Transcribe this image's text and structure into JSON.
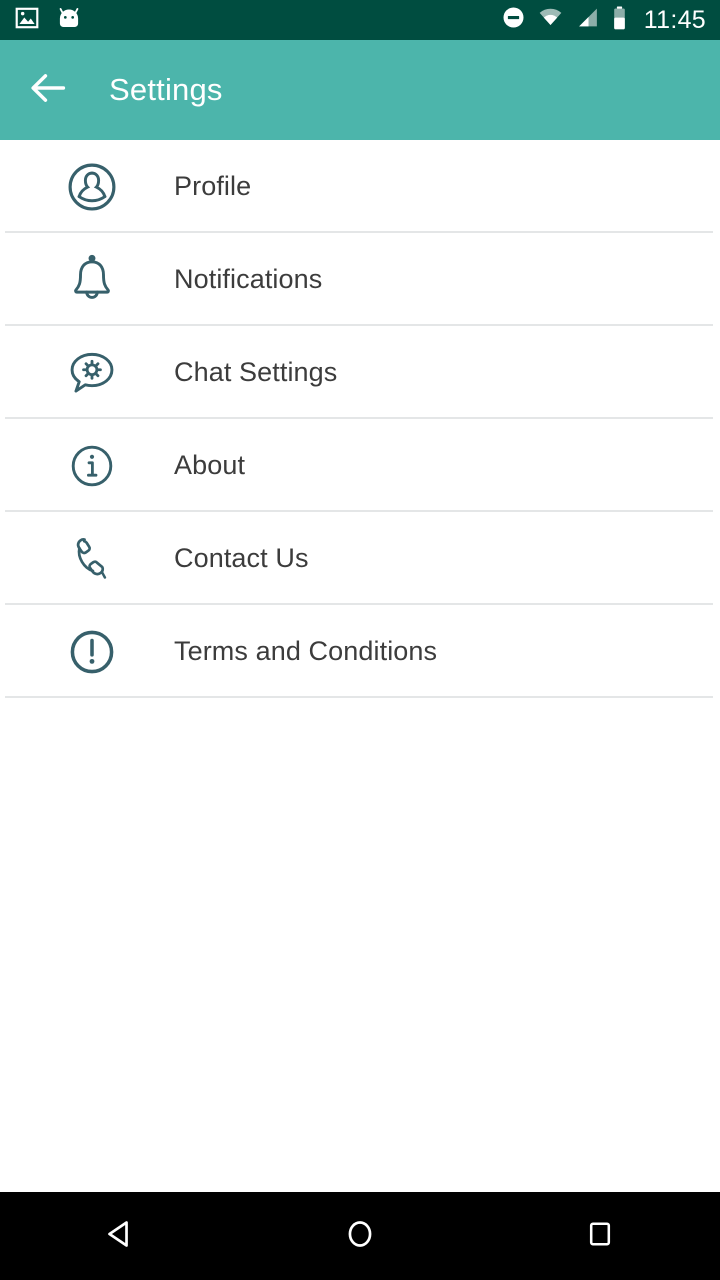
{
  "status_bar": {
    "time": "11:45",
    "background_color": "#004D40",
    "left_icons": [
      {
        "name": "photo-image-icon",
        "label": "Image"
      },
      {
        "name": "android-bugdroid-icon",
        "label": "Android"
      }
    ],
    "right_icons": [
      {
        "name": "do-not-disturb-icon",
        "label": "Do Not Disturb"
      },
      {
        "name": "wifi-icon",
        "label": "Wi-Fi"
      },
      {
        "name": "cellular-signal-icon",
        "label": "Cellular signal"
      },
      {
        "name": "battery-icon",
        "label": "Battery"
      }
    ]
  },
  "app_bar": {
    "title": "Settings",
    "back_label": "Back",
    "background_color": "#4CB5AB",
    "text_color": "#FFFFFF"
  },
  "settings": {
    "icon_color": "#37606B",
    "label_color": "#3C3C3C",
    "divider_color": "#E4E6E7",
    "items": [
      {
        "label": "Profile",
        "icon": "profile-person-circle-icon"
      },
      {
        "label": "Notifications",
        "icon": "bell-icon"
      },
      {
        "label": "Chat Settings",
        "icon": "chat-bubble-gear-icon"
      },
      {
        "label": "About",
        "icon": "info-circle-icon"
      },
      {
        "label": "Contact Us",
        "icon": "phone-handset-icon"
      },
      {
        "label": "Terms and Conditions",
        "icon": "exclamation-circle-icon"
      }
    ]
  },
  "nav_bar": {
    "background_color": "#000000",
    "buttons": [
      {
        "label": "Back",
        "icon": "nav-back-triangle-icon"
      },
      {
        "label": "Home",
        "icon": "nav-home-circle-icon"
      },
      {
        "label": "Recents",
        "icon": "nav-recents-square-icon"
      }
    ]
  }
}
